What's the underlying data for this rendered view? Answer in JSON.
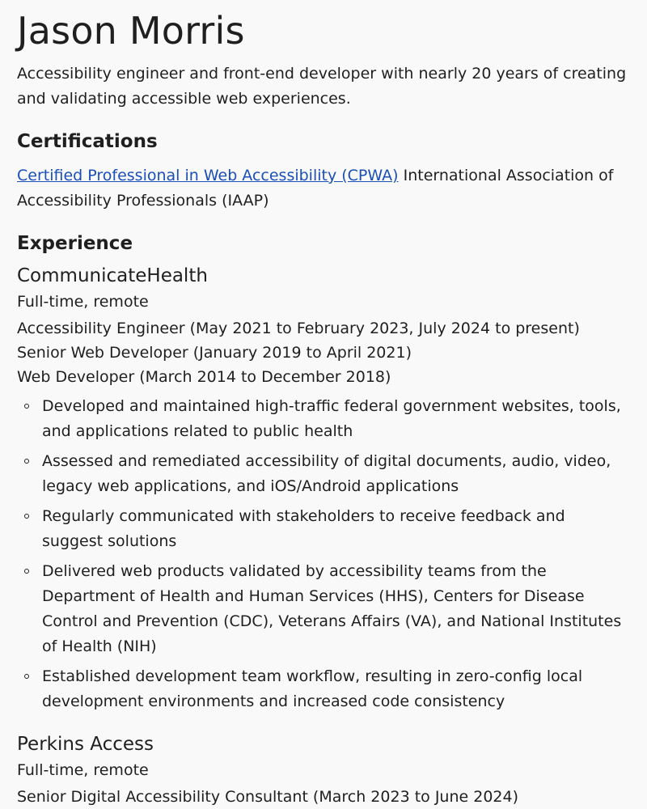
{
  "header": {
    "name": "Jason Morris",
    "summary": "Accessibility engineer and front-end developer with nearly 20 years of creating and validating accessible web experiences."
  },
  "certifications": {
    "heading": "Certifications",
    "items": [
      {
        "link_text": "Certified Professional in Web Accessibility (CPWA)",
        "issuer": " International Association of Accessibility Professionals (IAAP)"
      }
    ]
  },
  "experience": {
    "heading": "Experience",
    "companies": [
      {
        "name": "CommunicateHealth",
        "type": "Full-time, remote",
        "roles": [
          "Accessibility Engineer (May 2021 to February 2023, July 2024 to present)",
          "Senior Web Developer (January 2019 to April 2021)",
          "Web Developer (March 2014 to December 2018)"
        ],
        "bullets": [
          "Developed and maintained high-traffic federal government websites, tools, and applications related to public health",
          "Assessed and remediated accessibility of digital documents, audio, video, legacy web applications, and iOS/Android applications",
          "Regularly communicated with stakeholders to receive feedback and suggest solutions",
          "Delivered web products validated by accessibility teams from the Department of Health and Human Services (HHS), Centers for Disease Control and Prevention (CDC), Veterans Affairs (VA), and National Institutes of Health (NIH)",
          "Established development team workflow, resulting in zero-config local development environments and increased code consistency"
        ]
      },
      {
        "name": "Perkins Access",
        "type": "Full-time, remote",
        "roles": [
          "Senior Digital Accessibility Consultant (March 2023 to June 2024)"
        ]
      }
    ]
  }
}
